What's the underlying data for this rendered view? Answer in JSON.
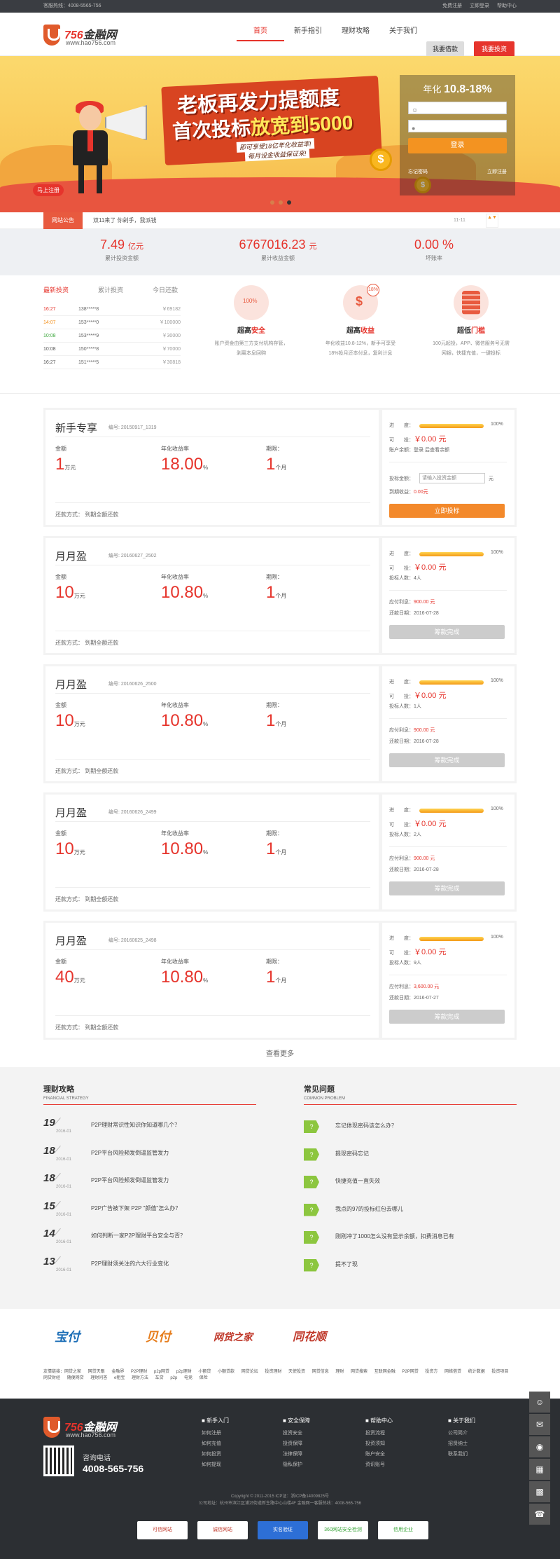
{
  "topbar": {
    "hotline": "客服热线：4008-5565-756",
    "links": [
      "免费注册",
      "立即登录",
      "帮助中心"
    ]
  },
  "header": {
    "brand_num": "756",
    "brand": "金融网",
    "url": "www.hao756.com",
    "nav": [
      "首页",
      "新手指引",
      "理财攻略",
      "关于我们"
    ],
    "borrow": "我要借款",
    "invest": "我要投资"
  },
  "banner": {
    "line1": "老板再发力提额度",
    "line2a": "首次投标",
    "line2b": "放宽到5000",
    "sub1": "即可享受18亿年化收益率!",
    "sub2": "每月设金收益保证来!",
    "tag": "马上注册",
    "coin": "$"
  },
  "login": {
    "rate_label": "年化",
    "rate": "10.8-18%",
    "user_ph": "",
    "pass_ph": "",
    "submit": "登录",
    "register": "立即注册",
    "forgot": "忘记密码"
  },
  "notice": {
    "tag": "网站公告",
    "text": "双11来了 你剁手，我派钱",
    "date": "11-11",
    "arrows": "▲▼"
  },
  "stats": [
    {
      "value": "7.49",
      "unit": "亿元",
      "label": "累计投资金额"
    },
    {
      "value": "6767016.23",
      "unit": "元",
      "label": "累计收益金额"
    },
    {
      "value": "0.00 %",
      "unit": "",
      "label": "坏账率"
    }
  ],
  "ranking": {
    "tabs": [
      "最新投资",
      "累计投资",
      "今日还款"
    ],
    "rows": [
      {
        "time": "16:27",
        "user": "138*****8",
        "amount": "￥69182"
      },
      {
        "time": "14:07",
        "user": "153*****0",
        "amount": "￥100000"
      },
      {
        "time": "10:08",
        "user": "153*****9",
        "amount": "￥30000"
      },
      {
        "time": "10:08",
        "user": "150*****8",
        "amount": "￥70000"
      },
      {
        "time": "16:27",
        "user": "151*****5",
        "amount": "￥30818"
      }
    ]
  },
  "features": [
    {
      "title_a": "超高",
      "title_b": "安全",
      "desc": "账户资金由第三方支付机构存管，\n剥离本息回购",
      "badge": "100%"
    },
    {
      "title_a": "超高",
      "title_b": "收益",
      "desc": "年化收益10.8-12%，新手可享受\n18%投月还本付息，复利计息",
      "badge": "18%"
    },
    {
      "title_a": "超低",
      "title_b": "门槛",
      "desc": "100元起投，APP、微信服务号无需\n网银，快捷充值，一键投标",
      "badge": ""
    }
  ],
  "products": [
    {
      "name": "新手专享",
      "no": "编号: 20150917_1319",
      "amount": "1",
      "amount_unit": "万元",
      "rate": "18.00",
      "period": "1",
      "period_unit": "个月",
      "progress": "100%",
      "avail": "￥0.00 元",
      "r3": "账户余额：登录 后查看余额",
      "r4": "投标金额：",
      "r4v": "请输入投资金额",
      "r4u": "元",
      "r5": "到期收益：",
      "r5v": "0.00元",
      "btn": "立即投标",
      "done": false
    },
    {
      "name": "月月盈",
      "no": "编号: 20160627_2502",
      "amount": "10",
      "amount_unit": "万元",
      "rate": "10.80",
      "period": "1",
      "period_unit": "个月",
      "progress": "100%",
      "avail": "￥0.00 元",
      "r3": "投标人数：4人",
      "r4": "应付利息：",
      "r4v": "900.00 元",
      "r5": "还款日期：",
      "r5v": "2016-07-28",
      "btn": "筹款完成",
      "done": true
    },
    {
      "name": "月月盈",
      "no": "编号: 20160626_2500",
      "amount": "10",
      "amount_unit": "万元",
      "rate": "10.80",
      "period": "1",
      "period_unit": "个月",
      "progress": "100%",
      "avail": "￥0.00 元",
      "r3": "投标人数：1人",
      "r4": "应付利息：",
      "r4v": "900.00 元",
      "r5": "还款日期：",
      "r5v": "2016-07-28",
      "btn": "筹款完成",
      "done": true
    },
    {
      "name": "月月盈",
      "no": "编号: 20160626_2499",
      "amount": "10",
      "amount_unit": "万元",
      "rate": "10.80",
      "period": "1",
      "period_unit": "个月",
      "progress": "100%",
      "avail": "￥0.00 元",
      "r3": "投标人数：2人",
      "r4": "应付利息：",
      "r4v": "900.00 元",
      "r5": "还款日期：",
      "r5v": "2016-07-28",
      "btn": "筹款完成",
      "done": true
    },
    {
      "name": "月月盈",
      "no": "编号: 20160625_2498",
      "amount": "40",
      "amount_unit": "万元",
      "rate": "10.80",
      "period": "1",
      "period_unit": "个月",
      "progress": "100%",
      "avail": "￥0.00 元",
      "r3": "投标人数：9人",
      "r4": "应付利息：",
      "r4v": "3,600.00 元",
      "r5": "还款日期：",
      "r5v": "2016-07-27",
      "btn": "筹款完成",
      "done": true
    }
  ],
  "product_labels": {
    "amount": "金额",
    "rate": "年化收益率",
    "period": "期限：",
    "repay": "还款方式： 到期全额还款",
    "progress": "进　　度：",
    "avail": "可　　投：",
    "pct": "%"
  },
  "more": "查看更多",
  "strategy": {
    "title": "理财攻略",
    "sub": "FINANCIAL STRATEGY",
    "items": [
      {
        "day": "19",
        "ym": "2016-01",
        "title": "P2P理财常识性知识你知道哪几个？"
      },
      {
        "day": "18",
        "ym": "2016-01",
        "title": "P2P平台风险频发倒逼监管发力"
      },
      {
        "day": "18",
        "ym": "2016-01",
        "title": "P2P平台风险频发倒逼监管发力"
      },
      {
        "day": "15",
        "ym": "2016-01",
        "title": "P2P广告被下架 P2P \"颜值\"怎么办？"
      },
      {
        "day": "14",
        "ym": "2016-01",
        "title": "如何判断一家P2P理财平台安全与否？"
      },
      {
        "day": "13",
        "ym": "2016-01",
        "title": "P2P理财须关注的六大行业变化"
      }
    ]
  },
  "faq": {
    "title": "常见问题",
    "sub": "COMMON PROBLEM",
    "items": [
      "忘记体现密码该怎么办？",
      "提现密码忘记",
      "快捷充值一直失效",
      "我点的97的投标红包去哪儿",
      "刚刚冲了1000怎么没有显示余额，扣费消息已有",
      "提不了现"
    ]
  },
  "partners": [
    "宝付",
    "贝付",
    "网贷之家",
    "同花顺"
  ],
  "friend_links": "友情链接：网贷之家 网贷天眼 金融界 P2P理财 p2p网贷 p2p理财 小额贷 小额贷款 网贷论坛 投资理财 天使投资 网贷信息 理财 网贷搜索 互联网金融 P2P网贷 投资方 网络借贷 统计数据 投资项目 网贷财经 随便网贷 理财问答 e租宝 理财方法 车贷 p2p 电竞 保险",
  "footer": {
    "brand_num": "756",
    "brand": "金融网",
    "url": "www.hao756.com",
    "hotline_label": "咨询电话",
    "hotline": "4008-565-756",
    "cols": [
      {
        "title": "新手入门",
        "links": [
          "如何注册",
          "如何充值",
          "如何投资",
          "如何提现"
        ]
      },
      {
        "title": "安全保障",
        "links": [
          "投资安全",
          "投资保障",
          "法律保障",
          "隐私保护"
        ]
      },
      {
        "title": "帮助中心",
        "links": [
          "投资流程",
          "投资须知",
          "账户安全",
          "资讯账号"
        ]
      },
      {
        "title": "关于我们",
        "links": [
          "公司简介",
          "招贤纳士",
          "联系我们"
        ]
      }
    ],
    "copy1": "Copyright © 2011-2015 ICP证：浙ICP备14009825号",
    "copy2": "公司地址：杭州市滨江区浦沿街道新生路中心山楼4F 金融网一客服热线：4008-565-756",
    "badges": [
      "可信网站",
      "诚信网站",
      "实名验证",
      "360网站安全检测",
      "信用企业"
    ]
  },
  "colors": {
    "accent": "#e6342c",
    "orange": "#f3892b",
    "footer_bg": "#2c2f33"
  }
}
